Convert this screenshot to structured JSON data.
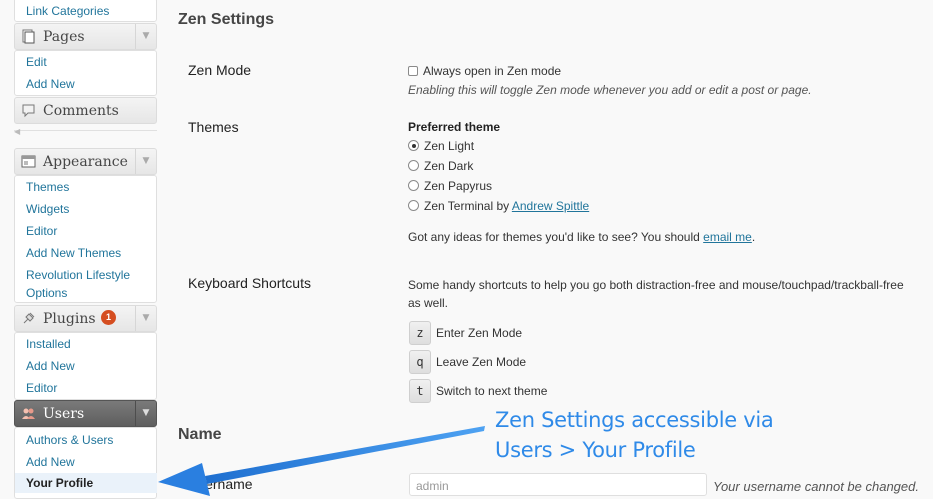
{
  "sidebar": {
    "link_categories": "Link Categories",
    "pages": {
      "label": "Pages",
      "items": [
        "Edit",
        "Add New"
      ]
    },
    "comments": {
      "label": "Comments"
    },
    "appearance": {
      "label": "Appearance",
      "items": [
        "Themes",
        "Widgets",
        "Editor",
        "Add New Themes",
        "Revolution Lifestyle",
        "Options"
      ]
    },
    "plugins": {
      "label": "Plugins",
      "badge": "1",
      "items": [
        "Installed",
        "Add New",
        "Editor"
      ]
    },
    "users": {
      "label": "Users",
      "items": [
        "Authors & Users",
        "Add New",
        "Your Profile"
      ]
    }
  },
  "zen": {
    "title": "Zen Settings",
    "mode": {
      "label": "Zen Mode",
      "checkbox_label": "Always open in Zen mode",
      "checked": false,
      "description": "Enabling this will toggle Zen mode whenever you add or edit a post or page."
    },
    "themes": {
      "label": "Themes",
      "heading": "Preferred theme",
      "options": [
        "Zen Light",
        "Zen Dark",
        "Zen Papyrus",
        "Zen Terminal"
      ],
      "selected": "Zen Light",
      "terminal_by": "by",
      "terminal_author": "Andrew Spittle",
      "ideas_text": "Got any ideas for themes you'd like to see? You should",
      "ideas_link": "email me",
      "ideas_end": "."
    },
    "shortcuts": {
      "label": "Keyboard Shortcuts",
      "description_line1": "Some handy shortcuts to help you go both distraction-free and mouse/touchpad/trackball-free",
      "description_line2": "as well.",
      "keys": [
        {
          "key": "z",
          "action": "Enter Zen Mode"
        },
        {
          "key": "q",
          "action": "Leave Zen Mode"
        },
        {
          "key": "t",
          "action": "Switch to next theme"
        }
      ]
    }
  },
  "name_section": {
    "title": "Name",
    "username_label": "Username",
    "username_value": "admin",
    "username_note": "Your username cannot be changed."
  },
  "callout": {
    "line1": "Zen Settings accessible via",
    "line2": "Users > Your Profile",
    "color": "#2f8ae8"
  },
  "colors": {
    "link": "#21759b",
    "badge": "#d54e21"
  }
}
